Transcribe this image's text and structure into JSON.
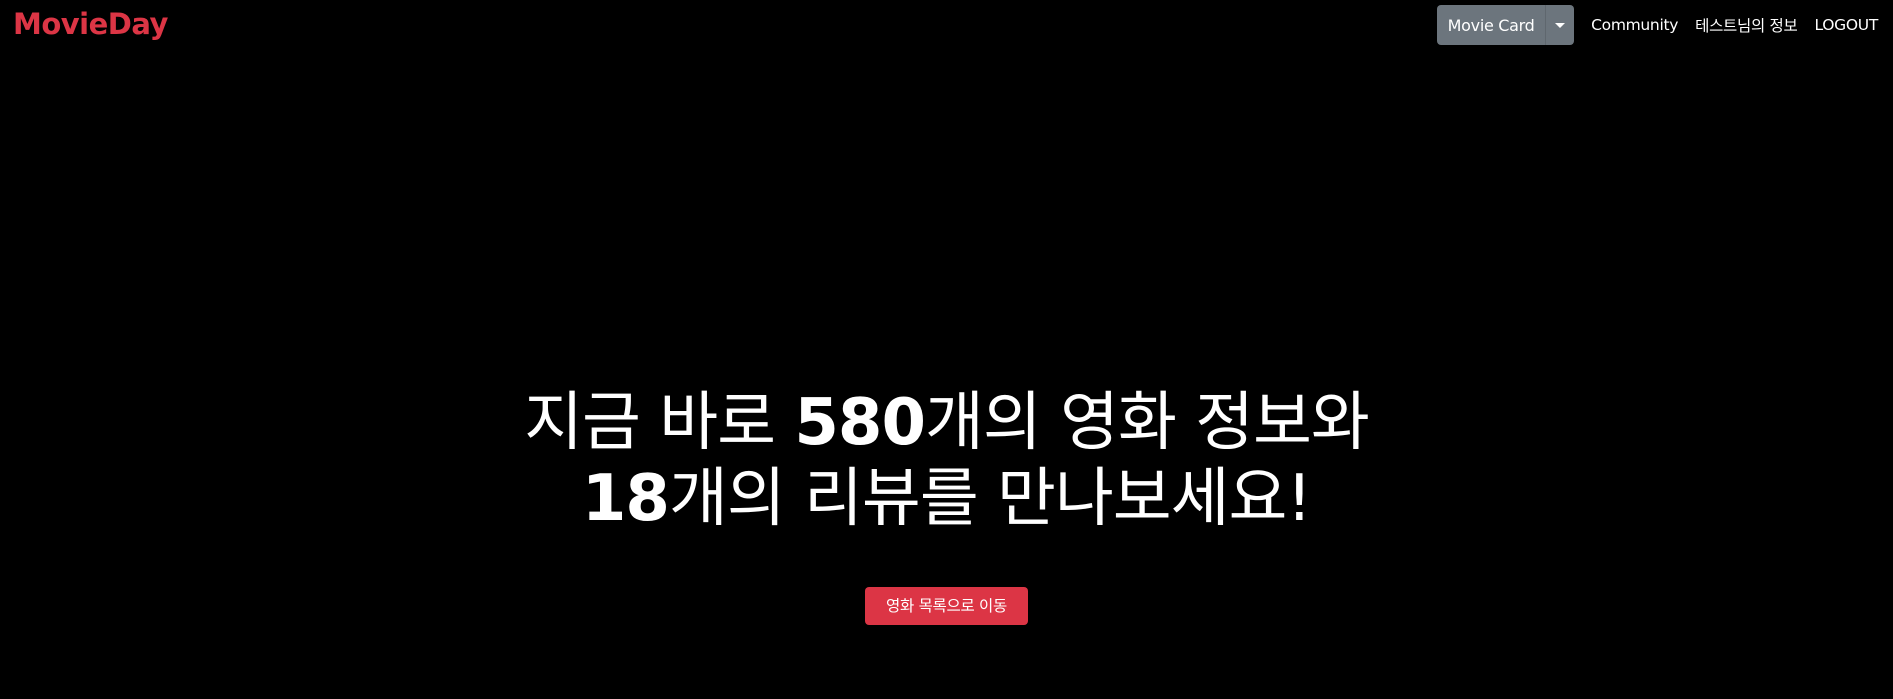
{
  "brand": {
    "name": "MovieDay",
    "color": "#dc3545"
  },
  "nav": {
    "dropdown": {
      "label": "Movie Card",
      "icon": "caret-down-icon"
    },
    "links": [
      {
        "label": "Community"
      },
      {
        "label": "테스트님의 정보"
      },
      {
        "label": "LOGOUT"
      }
    ]
  },
  "hero": {
    "line1_prefix": "지금 바로 ",
    "movie_count": "580",
    "line1_suffix": "개의 영화 정보와",
    "review_count": "18",
    "line2_suffix": "개의 리뷰를 만나보세요!"
  },
  "cta": {
    "label": "영화 목록으로 이동",
    "color": "#dc3545"
  },
  "colors": {
    "background": "#000000",
    "dropdown_bg": "#6c757d",
    "text": "#ffffff"
  }
}
